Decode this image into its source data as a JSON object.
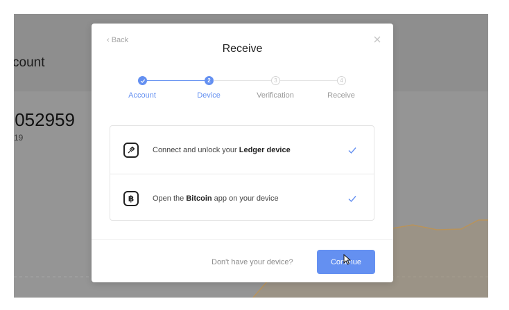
{
  "background": {
    "header_title": "count",
    "balance": ".052959",
    "balance_sub": "19"
  },
  "modal": {
    "back_label": "‹ Back",
    "title": "Receive",
    "steps": [
      {
        "number": "1",
        "label": "Account",
        "state": "done"
      },
      {
        "number": "2",
        "label": "Device",
        "state": "active"
      },
      {
        "number": "3",
        "label": "Verification",
        "state": "todo"
      },
      {
        "number": "4",
        "label": "Receive",
        "state": "todo"
      }
    ],
    "tasks": [
      {
        "text_before": "Connect and unlock your ",
        "text_bold": "Ledger device",
        "text_after": "",
        "icon": "plug-icon",
        "status": "checked"
      },
      {
        "text_before": "Open the ",
        "text_bold": "Bitcoin",
        "text_after": " app on your device",
        "icon": "bitcoin-icon",
        "status": "checked"
      }
    ],
    "footer": {
      "no_device_label": "Don't have your device?",
      "continue_label": "Continue"
    }
  },
  "colors": {
    "accent": "#6490f1",
    "overlay": "#8e8e8e",
    "chart_line": "#b9935a"
  }
}
